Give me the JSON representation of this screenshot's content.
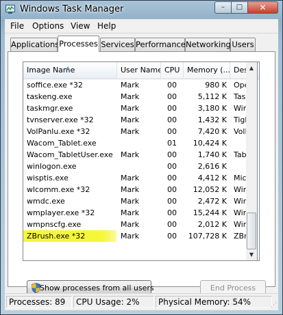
{
  "window": {
    "title": "Windows Task Manager",
    "minimize_glyph": "–",
    "maximize_glyph": "□",
    "close_glyph": "✕"
  },
  "menu": [
    "File",
    "Options",
    "View",
    "Help"
  ],
  "tabs": [
    {
      "label": "Applications",
      "active": false
    },
    {
      "label": "Processes",
      "active": true
    },
    {
      "label": "Services",
      "active": false
    },
    {
      "label": "Performance",
      "active": false
    },
    {
      "label": "Networking",
      "active": false
    },
    {
      "label": "Users",
      "active": false
    }
  ],
  "table": {
    "columns": {
      "name": "Image Name",
      "user": "User Name",
      "cpu": "CPU",
      "memory": "Memory (...",
      "description": "Desc"
    },
    "sort_indicator": "▲",
    "rows": [
      {
        "name": "soffice.exe *32",
        "user": "Mark",
        "cpu": "00",
        "memory": "980 K",
        "description": "Open"
      },
      {
        "name": "taskeng.exe",
        "user": "Mark",
        "cpu": "00",
        "memory": "5,112 K",
        "description": "Task"
      },
      {
        "name": "taskmgr.exe",
        "user": "Mark",
        "cpu": "00",
        "memory": "3,180 K",
        "description": "Wind"
      },
      {
        "name": "tvnserver.exe *32",
        "user": "Mark",
        "cpu": "00",
        "memory": "1,432 K",
        "description": "Tight"
      },
      {
        "name": "VolPanlu.exe *32",
        "user": "Mark",
        "cpu": "00",
        "memory": "7,420 K",
        "description": "VolPa"
      },
      {
        "name": "Wacom_Tablet.exe",
        "user": "",
        "cpu": "01",
        "memory": "10,424 K",
        "description": ""
      },
      {
        "name": "Wacom_TabletUser.exe",
        "user": "Mark",
        "cpu": "00",
        "memory": "1,740 K",
        "description": "Table"
      },
      {
        "name": "winlogon.exe",
        "user": "",
        "cpu": "00",
        "memory": "2,616 K",
        "description": ""
      },
      {
        "name": "wisptis.exe",
        "user": "Mark",
        "cpu": "00",
        "memory": "4,412 K",
        "description": "Micro"
      },
      {
        "name": "wlcomm.exe *32",
        "user": "Mark",
        "cpu": "00",
        "memory": "12,052 K",
        "description": "Wind"
      },
      {
        "name": "wmdc.exe",
        "user": "Mark",
        "cpu": "00",
        "memory": "2,472 K",
        "description": "Wind"
      },
      {
        "name": "wmplayer.exe *32",
        "user": "Mark",
        "cpu": "00",
        "memory": "15,244 K",
        "description": "Wind"
      },
      {
        "name": "wmpnscfg.exe",
        "user": "Mark",
        "cpu": "00",
        "memory": "2,012 K",
        "description": "Wind"
      },
      {
        "name": "ZBrush.exe *32",
        "user": "Mark",
        "cpu": "00",
        "memory": "107,728 K",
        "description": "ZBrus",
        "highlighted": true
      }
    ]
  },
  "scrollbar": {
    "up_glyph": "▲",
    "down_glyph": "▼"
  },
  "buttons": {
    "show_all": "Show processes from all users",
    "end_process": "End Process"
  },
  "status": {
    "processes": "Processes: 89",
    "cpu": "CPU Usage: 2%",
    "memory": "Physical Memory: 54%"
  },
  "colors": {
    "highlight": "#f7f73a",
    "disabled_text": "#8d8d8d"
  }
}
